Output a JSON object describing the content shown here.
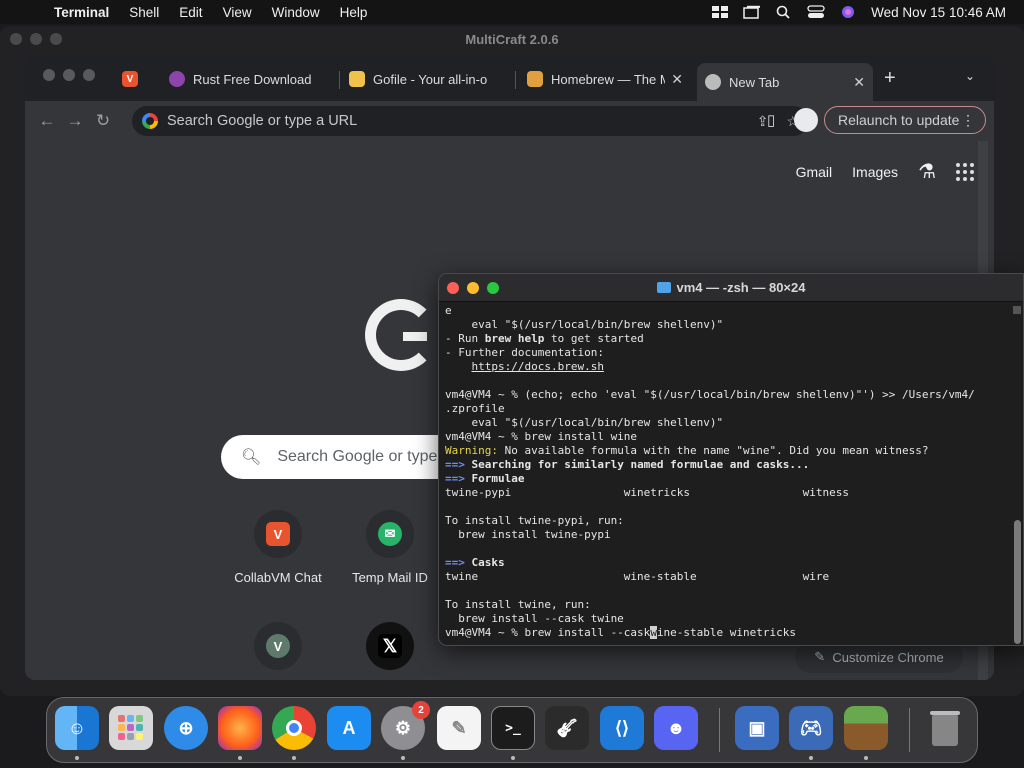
{
  "menubar": {
    "app": "Terminal",
    "items": [
      "Shell",
      "Edit",
      "View",
      "Window",
      "Help"
    ],
    "clock": "Wed Nov 15  10:46 AM"
  },
  "bg_window": {
    "title": "MultiCraft 2.0.6"
  },
  "chrome": {
    "tabs": [
      {
        "label": "Rust Free Download",
        "icon": "purple-globe-icon",
        "color": "#8e44ad"
      },
      {
        "label": "Gofile - Your all-in-o",
        "icon": "gofile-icon",
        "color": "#f0c14b"
      },
      {
        "label": "Homebrew — The M",
        "icon": "homebrew-mug-icon",
        "color": "#e0a040"
      },
      {
        "label": "New Tab",
        "icon": "chrome-icon",
        "color": "#bbbbbb",
        "active": true
      }
    ],
    "omnibox_placeholder": "Search Google or type a URL",
    "relaunch_label": "Relaunch to update",
    "ntp": {
      "gmail": "Gmail",
      "images": "Images",
      "search_placeholder": "Search Google or type a URL",
      "shortcuts": [
        {
          "label": "CollabVM Chat",
          "icon": "collabvm-icon",
          "color": "#e8542d",
          "glyph": "V"
        },
        {
          "label": "Temp Mail ID",
          "icon": "tempmail-icon",
          "color": "#28b36a",
          "glyph": "✉"
        },
        {
          "label": "",
          "icon": "v-letter-icon",
          "color": "#5f7a6a",
          "glyph": "V"
        },
        {
          "label": "",
          "icon": "x-twitter-icon",
          "color": "#000000",
          "glyph": "X"
        }
      ],
      "customize_label": "Customize Chrome"
    }
  },
  "terminal": {
    "title": "vm4 — -zsh — 80×24"
  },
  "dock": {
    "items": [
      {
        "name": "finder",
        "color": "#3b8fe8"
      },
      {
        "name": "launchpad",
        "color": "#d8d8d8"
      },
      {
        "name": "safari",
        "color": "#2f8be8"
      },
      {
        "name": "firefox",
        "color": "#ff7a1a"
      },
      {
        "name": "chrome",
        "color": "#f2f2f2"
      },
      {
        "name": "app-store",
        "color": "#1d8cf0"
      },
      {
        "name": "system-settings",
        "color": "#8e8e93",
        "badge": "2"
      },
      {
        "name": "textedit",
        "color": "#f4f4f4"
      },
      {
        "name": "terminal",
        "color": "#1c1c1c"
      },
      {
        "name": "garageband",
        "color": "#2b2b2b"
      },
      {
        "name": "vscode",
        "color": "#1e7ad6"
      },
      {
        "name": "discord",
        "color": "#5865f2"
      },
      {
        "name": "virtualbox",
        "color": "#3a6cc0"
      },
      {
        "name": "gamecontroller",
        "color": "#3b6ab8"
      },
      {
        "name": "multicraft",
        "color": "#6aa84f"
      },
      {
        "name": "trash",
        "color": "#9a9a9a"
      }
    ]
  }
}
